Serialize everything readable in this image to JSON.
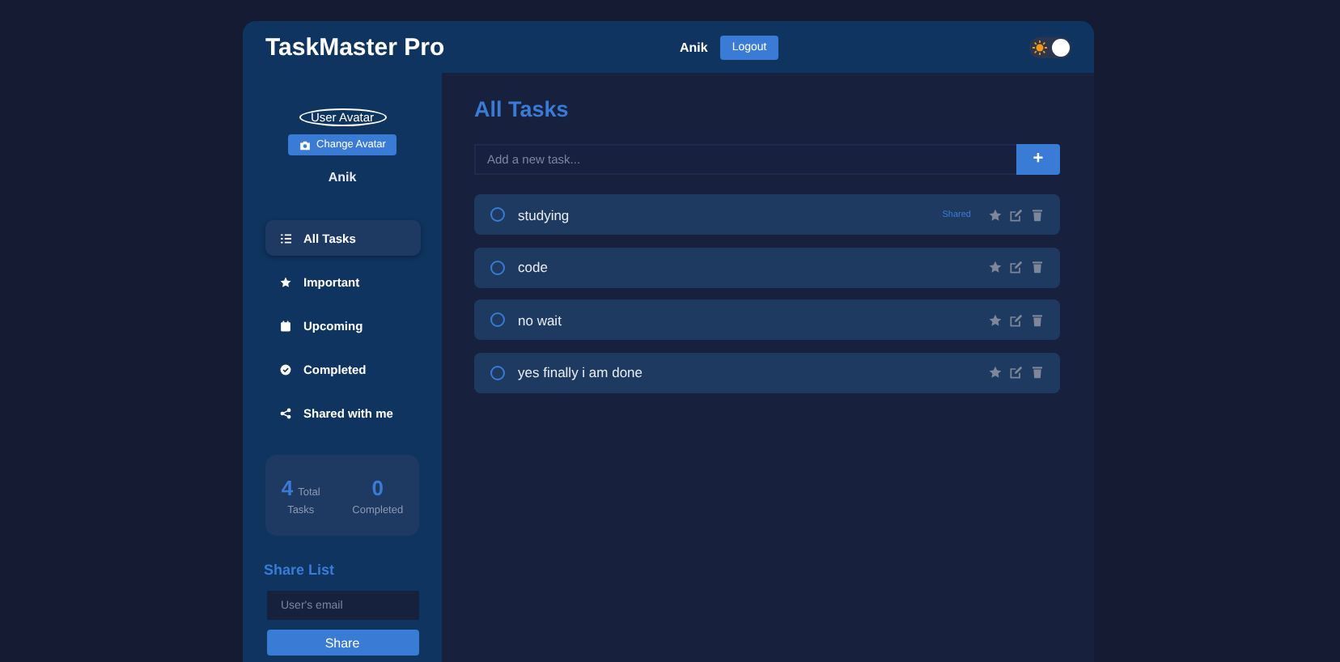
{
  "header": {
    "title": "TaskMaster Pro",
    "user_name": "Anik",
    "logout_label": "Logout",
    "theme_toggle": {
      "on": true
    }
  },
  "sidebar": {
    "avatar_alt": "User Avatar",
    "change_avatar_label": "Change Avatar",
    "user_name": "Anik",
    "items": [
      {
        "label": "All Tasks",
        "selected": true
      },
      {
        "label": "Important",
        "selected": false
      },
      {
        "label": "Upcoming",
        "selected": false
      },
      {
        "label": "Completed",
        "selected": false
      },
      {
        "label": "Shared with me",
        "selected": false
      }
    ],
    "stats": [
      {
        "value": "4",
        "label_1": "Total",
        "label_2": "Tasks"
      },
      {
        "value": "0",
        "label_2": "Completed"
      }
    ],
    "share": {
      "title": "Share List",
      "placeholder": "User's email",
      "button": "Share"
    }
  },
  "main": {
    "title": "All Tasks",
    "new_task": {
      "placeholder": "Add a new task...",
      "button": "+"
    },
    "tasks": [
      {
        "text": "studying",
        "completed": false,
        "important": false,
        "badge": "Shared"
      },
      {
        "text": "code",
        "completed": false,
        "important": false
      },
      {
        "text": "no wait",
        "completed": false,
        "important": false
      },
      {
        "text": "yes finally i am done",
        "completed": false,
        "important": false
      }
    ]
  }
}
